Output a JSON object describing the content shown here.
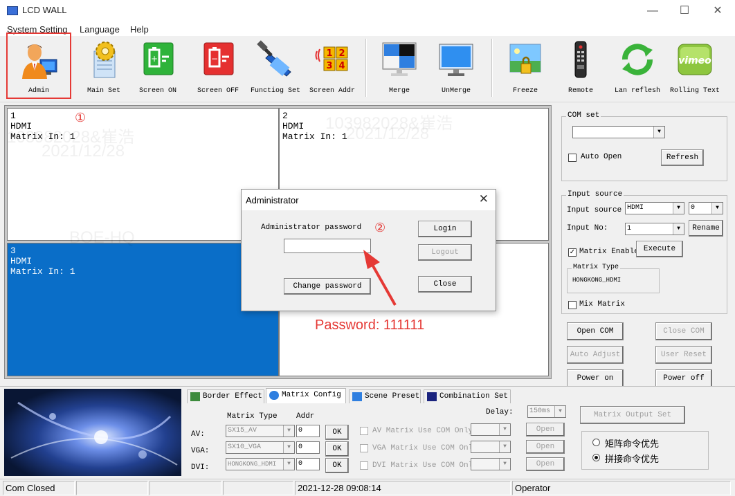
{
  "window": {
    "title": "LCD WALL",
    "controls": {
      "minimize": "—",
      "maximize": "☐",
      "close": "✕"
    }
  },
  "menu": [
    "System Setting",
    "Language",
    "Help"
  ],
  "toolbar": {
    "items": [
      {
        "label": "Admin",
        "icon": "admin-user-icon"
      },
      {
        "label": "Main Set",
        "icon": "gear-document-icon"
      },
      {
        "label": "Screen ON",
        "icon": "battery-on-icon"
      },
      {
        "label": "Screen OFF",
        "icon": "battery-off-icon"
      },
      {
        "label": "Functiog Set",
        "icon": "hammer-monitor-icon"
      },
      {
        "label": "Screen Addr",
        "icon": "numbered-grid-icon"
      },
      {
        "label": "Merge",
        "icon": "merge-monitor-icon"
      },
      {
        "label": "UnMerge",
        "icon": "monitor-icon"
      },
      {
        "label": "Freeze",
        "icon": "freeze-lock-icon"
      },
      {
        "label": "Remote",
        "icon": "remote-control-icon"
      },
      {
        "label": "Lan reflesh",
        "icon": "refresh-arrows-icon"
      },
      {
        "label": "Rolling Text",
        "icon": "vimeo-icon"
      }
    ],
    "grid_digits": [
      "1",
      "2",
      "3",
      "4"
    ],
    "vimeo_text": "vimeo"
  },
  "screens": [
    {
      "num": "1",
      "src": "HDMI",
      "matrix": "Matrix In: 1",
      "selected": false
    },
    {
      "num": "2",
      "src": "HDMI",
      "matrix": "Matrix In: 1",
      "selected": false
    },
    {
      "num": "3",
      "src": "HDMI",
      "matrix": "Matrix In: 1",
      "selected": true
    },
    {
      "num": "",
      "src": "",
      "matrix": "",
      "selected": false
    }
  ],
  "annotations": {
    "step1": "①",
    "step2": "②",
    "password_note": "Password: 111111"
  },
  "dialog": {
    "title": "Administrator",
    "close": "✕",
    "password_label": "Administrator password",
    "password_value": "",
    "login": "Login",
    "logout": "Logout",
    "change_password": "Change password",
    "close_button": "Close"
  },
  "com_set": {
    "legend": "COM set",
    "port_value": "",
    "auto_open_label": "Auto Open",
    "auto_open_checked": false,
    "refresh": "Refresh"
  },
  "input_source": {
    "legend": "Input source",
    "source_label": "Input source",
    "source_value": "HDMI",
    "source_index_value": "0",
    "input_no_label": "Input No:",
    "input_no_value": "1",
    "rename": "Rename",
    "matrix_enable_label": "Matrix Enable",
    "matrix_enable_checked": true,
    "execute": "Execute",
    "matrix_type_legend": "Matrix Type",
    "matrix_type_value": "HONGKONG_HDMI",
    "mix_matrix_label": "Mix Matrix",
    "mix_matrix_checked": false
  },
  "com_buttons": {
    "open_com": "Open COM",
    "close_com": "Close COM",
    "auto_adjust": "Auto Adjust",
    "user_reset": "User Reset",
    "power_on": "Power on",
    "power_off": "Power off"
  },
  "tabs": [
    "Border Effect",
    "Matrix Config",
    "Scene Preset",
    "Combination Set"
  ],
  "active_tab": "Matrix Config",
  "matrix_config": {
    "matrix_type_header": "Matrix Type",
    "addr_header": "Addr",
    "delay_label": "Delay:",
    "delay_value": "150ms",
    "output_set": "Matrix Output Set",
    "rows": [
      {
        "label": "AV:",
        "type": "SX15_AV",
        "addr": "0",
        "ok": "OK",
        "use_com": "AV Matrix Use COM Only",
        "open": "Open"
      },
      {
        "label": "VGA:",
        "type": "SX10_VGA",
        "addr": "0",
        "ok": "OK",
        "use_com": "VGA Matrix Use COM Only",
        "open": "Open"
      },
      {
        "label": "DVI:",
        "type": "HONGKONG_HDMI",
        "addr": "0",
        "ok": "OK",
        "use_com": "DVI Matrix Use COM Only",
        "open": "Open"
      }
    ],
    "priority_options": [
      "矩阵命令优先",
      "拼接命令优先"
    ],
    "priority_selected": 1
  },
  "status": {
    "com": "Com Closed",
    "datetime": "2021-12-28 09:08:14",
    "role": "Operator"
  },
  "watermarks": [
    "103982028&崔浩",
    "2021/12/28",
    "BOE-HQ"
  ]
}
